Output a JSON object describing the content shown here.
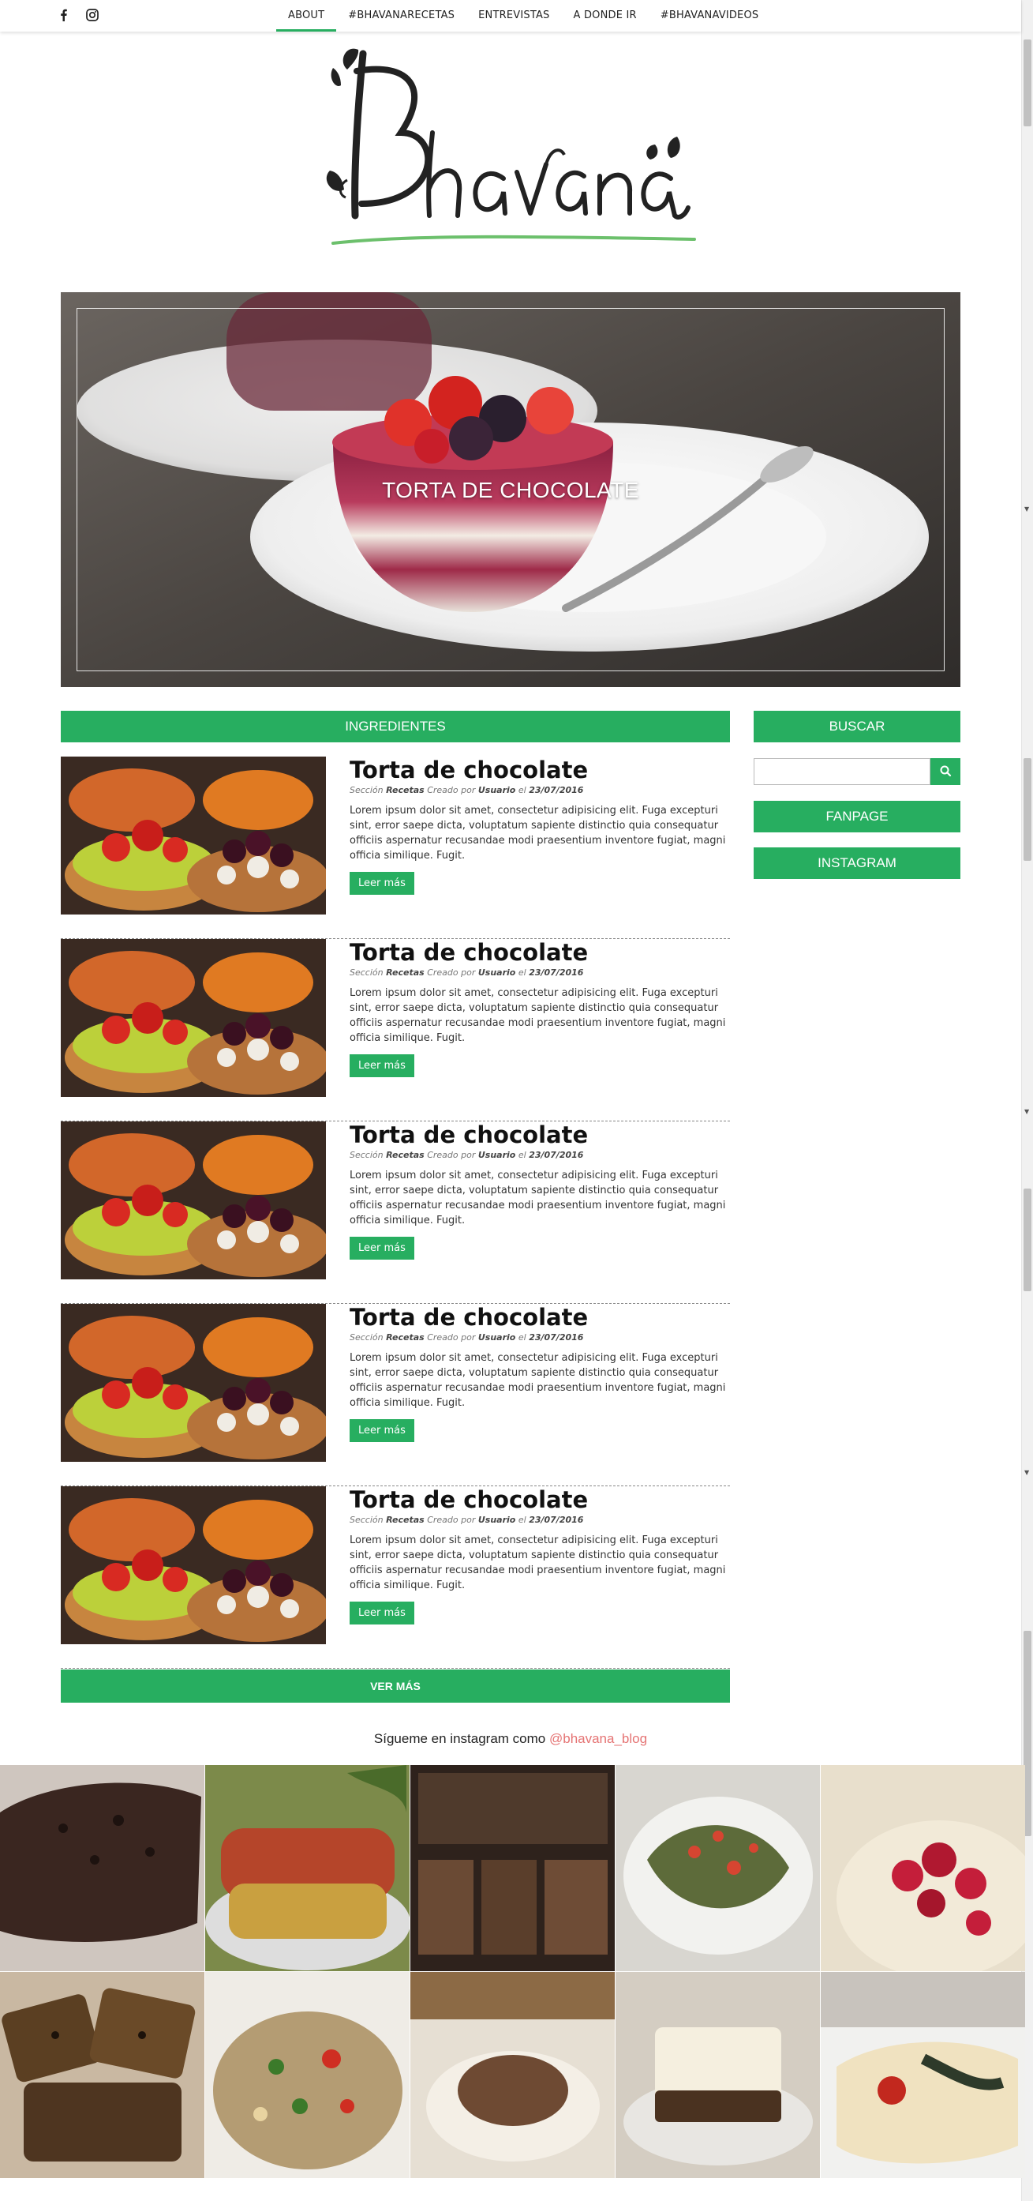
{
  "topbar": {
    "social": [
      {
        "icon": "facebook-icon"
      },
      {
        "icon": "instagram-icon"
      }
    ],
    "nav": [
      {
        "label": "ABOUT",
        "active": true
      },
      {
        "label": "#BHAVANARECETAS"
      },
      {
        "label": "ENTREVISTAS"
      },
      {
        "label": "A DONDE IR"
      },
      {
        "label": "#BHAVANAVIDEOS"
      }
    ]
  },
  "logo": {
    "text": "Bhavana"
  },
  "hero": {
    "title": "TORTA DE CHOCOLATE"
  },
  "section": {
    "title": "INGREDIENTES"
  },
  "articles": [
    {
      "title": "Torta de chocolate",
      "meta_prefix": "Sección",
      "category": "Recetas",
      "meta_created": "Creado por",
      "author": "Usuario",
      "meta_on": "el",
      "date": "23/07/2016",
      "excerpt": "Lorem ipsum dolor sit amet, consectetur adipisicing elit. Fuga excepturi sint, error saepe dicta, voluptatum sapiente distinctio quia consequatur officiis aspernatur recusandae modi praesentium inventore fugiat, magni officia similique. Fugit.",
      "button": "Leer más"
    },
    {
      "title": "Torta de chocolate",
      "meta_prefix": "Sección",
      "category": "Recetas",
      "meta_created": "Creado por",
      "author": "Usuario",
      "meta_on": "el",
      "date": "23/07/2016",
      "excerpt": "Lorem ipsum dolor sit amet, consectetur adipisicing elit. Fuga excepturi sint, error saepe dicta, voluptatum sapiente distinctio quia consequatur officiis aspernatur recusandae modi praesentium inventore fugiat, magni officia similique. Fugit.",
      "button": "Leer más"
    },
    {
      "title": "Torta de chocolate",
      "meta_prefix": "Sección",
      "category": "Recetas",
      "meta_created": "Creado por",
      "author": "Usuario",
      "meta_on": "el",
      "date": "23/07/2016",
      "excerpt": "Lorem ipsum dolor sit amet, consectetur adipisicing elit. Fuga excepturi sint, error saepe dicta, voluptatum sapiente distinctio quia consequatur officiis aspernatur recusandae modi praesentium inventore fugiat, magni officia similique. Fugit.",
      "button": "Leer más"
    },
    {
      "title": "Torta de chocolate",
      "meta_prefix": "Sección",
      "category": "Recetas",
      "meta_created": "Creado por",
      "author": "Usuario",
      "meta_on": "el",
      "date": "23/07/2016",
      "excerpt": "Lorem ipsum dolor sit amet, consectetur adipisicing elit. Fuga excepturi sint, error saepe dicta, voluptatum sapiente distinctio quia consequatur officiis aspernatur recusandae modi praesentium inventore fugiat, magni officia similique. Fugit.",
      "button": "Leer más"
    },
    {
      "title": "Torta de chocolate",
      "meta_prefix": "Sección",
      "category": "Recetas",
      "meta_created": "Creado por",
      "author": "Usuario",
      "meta_on": "el",
      "date": "23/07/2016",
      "excerpt": "Lorem ipsum dolor sit amet, consectetur adipisicing elit. Fuga excepturi sint, error saepe dicta, voluptatum sapiente distinctio quia consequatur officiis aspernatur recusandae modi praesentium inventore fugiat, magni officia similique. Fugit.",
      "button": "Leer más"
    }
  ],
  "more_button": "VER MÁS",
  "sidebar": {
    "search_title": "BUSCAR",
    "search_value": "",
    "fanpage": "FANPAGE",
    "instagram": "INSTAGRAM"
  },
  "instagram": {
    "prefix": "Sígueme en instagram como",
    "handle": "@bhavana_blog"
  },
  "colors": {
    "accent": "#27ae60",
    "handle": "#e57373"
  }
}
